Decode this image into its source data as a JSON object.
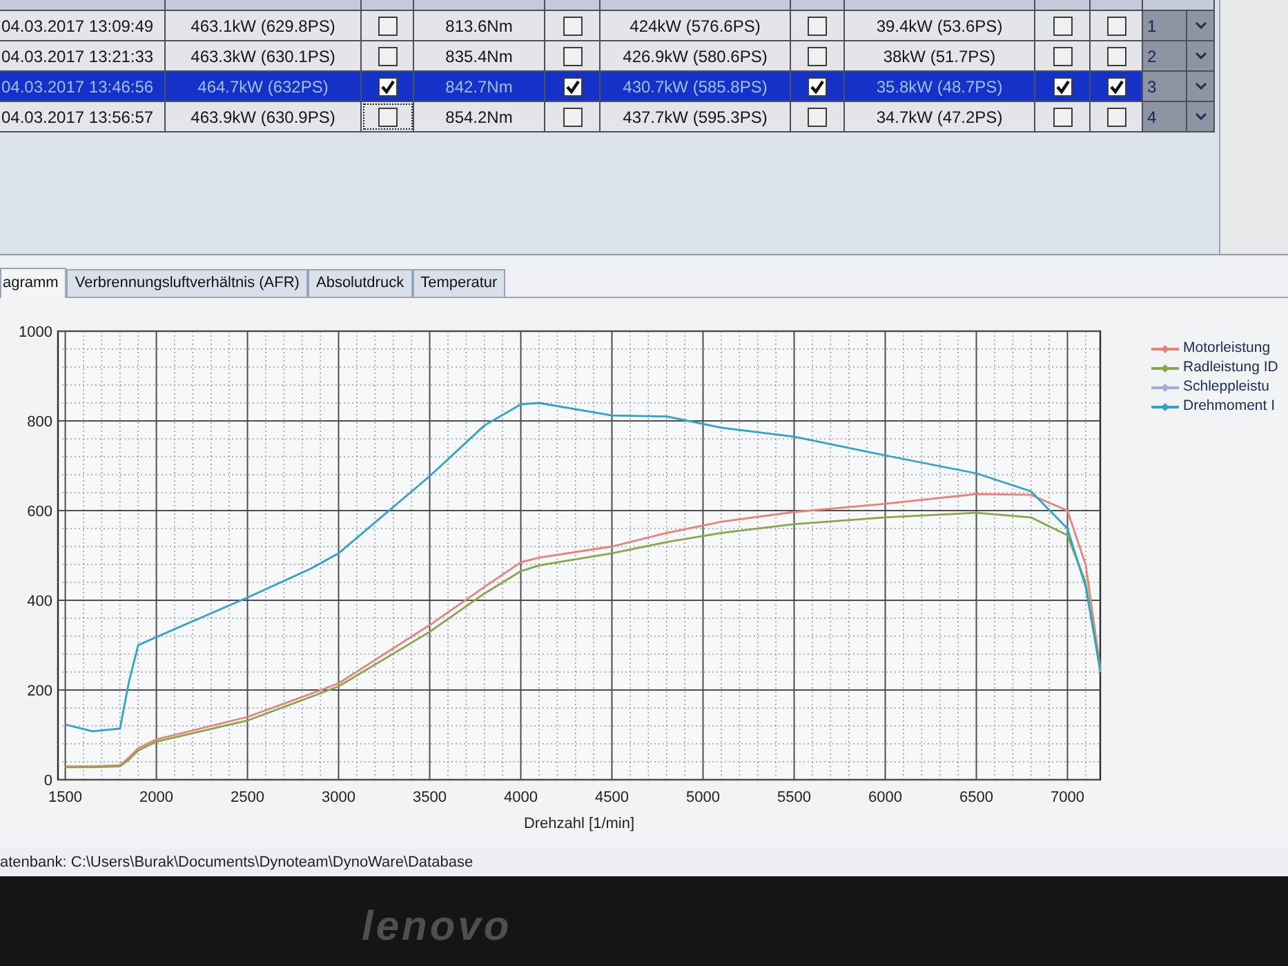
{
  "table": {
    "rows": [
      {
        "selected": false,
        "cells": [
          {
            "kind": "text",
            "text": "04.03.2017 13:09:49"
          },
          {
            "kind": "text",
            "text": "463.1kW (629.8PS)"
          },
          {
            "kind": "check",
            "checked": false,
            "focused": false
          },
          {
            "kind": "text",
            "text": "813.6Nm"
          },
          {
            "kind": "check",
            "checked": false,
            "focused": false
          },
          {
            "kind": "text",
            "text": "424kW (576.6PS)"
          },
          {
            "kind": "check",
            "checked": false,
            "focused": false
          },
          {
            "kind": "text",
            "text": "39.4kW (53.6PS)"
          },
          {
            "kind": "check",
            "checked": false,
            "focused": false
          },
          {
            "kind": "check",
            "checked": false,
            "focused": false
          },
          {
            "kind": "dropdown",
            "value": "1"
          }
        ]
      },
      {
        "selected": false,
        "cells": [
          {
            "kind": "text",
            "text": "04.03.2017 13:21:33"
          },
          {
            "kind": "text",
            "text": "463.3kW (630.1PS)"
          },
          {
            "kind": "check",
            "checked": false,
            "focused": false
          },
          {
            "kind": "text",
            "text": "835.4Nm"
          },
          {
            "kind": "check",
            "checked": false,
            "focused": false
          },
          {
            "kind": "text",
            "text": "426.9kW (580.6PS)"
          },
          {
            "kind": "check",
            "checked": false,
            "focused": false
          },
          {
            "kind": "text",
            "text": "38kW (51.7PS)"
          },
          {
            "kind": "check",
            "checked": false,
            "focused": false
          },
          {
            "kind": "check",
            "checked": false,
            "focused": false
          },
          {
            "kind": "dropdown",
            "value": "2"
          }
        ]
      },
      {
        "selected": true,
        "cells": [
          {
            "kind": "text",
            "text": "04.03.2017 13:46:56"
          },
          {
            "kind": "text",
            "text": "464.7kW (632PS)"
          },
          {
            "kind": "check",
            "checked": true,
            "focused": false
          },
          {
            "kind": "text",
            "text": "842.7Nm"
          },
          {
            "kind": "check",
            "checked": true,
            "focused": false
          },
          {
            "kind": "text",
            "text": "430.7kW (585.8PS)"
          },
          {
            "kind": "check",
            "checked": true,
            "focused": false
          },
          {
            "kind": "text",
            "text": "35.8kW (48.7PS)"
          },
          {
            "kind": "check",
            "checked": true,
            "focused": false
          },
          {
            "kind": "check",
            "checked": true,
            "focused": false
          },
          {
            "kind": "dropdown",
            "value": "3"
          }
        ]
      },
      {
        "selected": false,
        "cells": [
          {
            "kind": "text",
            "text": "04.03.2017 13:56:57"
          },
          {
            "kind": "text",
            "text": "463.9kW (630.9PS)"
          },
          {
            "kind": "check",
            "checked": false,
            "focused": true
          },
          {
            "kind": "text",
            "text": "854.2Nm"
          },
          {
            "kind": "check",
            "checked": false,
            "focused": false
          },
          {
            "kind": "text",
            "text": "437.7kW (595.3PS)"
          },
          {
            "kind": "check",
            "checked": false,
            "focused": false
          },
          {
            "kind": "text",
            "text": "34.7kW (47.2PS)"
          },
          {
            "kind": "check",
            "checked": false,
            "focused": false
          },
          {
            "kind": "check",
            "checked": false,
            "focused": false
          },
          {
            "kind": "dropdown",
            "value": "4"
          }
        ]
      }
    ]
  },
  "tabs": [
    {
      "label": "agramm",
      "selected": true
    },
    {
      "label": "Verbrennungsluftverhältnis (AFR)",
      "selected": false
    },
    {
      "label": "Absolutdruck",
      "selected": false
    },
    {
      "label": "Temperatur",
      "selected": false
    }
  ],
  "chart": {
    "chart_data": {
      "type": "line",
      "xlabel": "Drehzahl [1/min]",
      "x": [
        1500,
        1650,
        1800,
        1850,
        1900,
        2000,
        2500,
        2850,
        3000,
        3500,
        3800,
        4000,
        4100,
        4500,
        4800,
        5100,
        5500,
        6000,
        6500,
        6800,
        7000,
        7100,
        7180
      ],
      "series": [
        {
          "name": "Motorleistung",
          "color": "#e8837a",
          "values": [
            30,
            30,
            32,
            50,
            70,
            90,
            140,
            192,
            215,
            345,
            430,
            485,
            495,
            520,
            550,
            575,
            597,
            615,
            637,
            635,
            600,
            480,
            250
          ]
        },
        {
          "name": "Radleistung ID",
          "color": "#8aa64a",
          "values": [
            28,
            28,
            30,
            45,
            65,
            85,
            132,
            185,
            208,
            330,
            415,
            465,
            478,
            505,
            530,
            550,
            570,
            585,
            595,
            585,
            545,
            440,
            240
          ]
        },
        {
          "name": "Schleppleistu",
          "color": "#a3acd8",
          "values": [
            null,
            null,
            null,
            null,
            null,
            null,
            null,
            null,
            null,
            null,
            null,
            null,
            null,
            null,
            null,
            null,
            null,
            null,
            null,
            null,
            null,
            null,
            null
          ]
        },
        {
          "name": "Drehmoment I",
          "color": "#2fa3cc",
          "values": [
            123,
            108,
            114,
            220,
            300,
            318,
            406,
            471,
            505,
            677,
            790,
            837,
            840,
            812,
            810,
            785,
            765,
            723,
            683,
            643,
            560,
            430,
            246
          ]
        }
      ],
      "xlim": [
        1460,
        7180
      ],
      "ylim": [
        0,
        1000
      ],
      "xticks": [
        1500,
        2000,
        2500,
        3000,
        3500,
        4000,
        4500,
        5000,
        5500,
        6000,
        6500,
        7000
      ],
      "yticks": [
        0,
        200,
        400,
        600,
        800,
        1000
      ],
      "grid": true
    }
  },
  "status_bar": {
    "text": "atenbank: C:\\Users\\Burak\\Documents\\Dynoteam\\DynoWare\\Database"
  },
  "bezel": {
    "logo": "lenovo"
  }
}
